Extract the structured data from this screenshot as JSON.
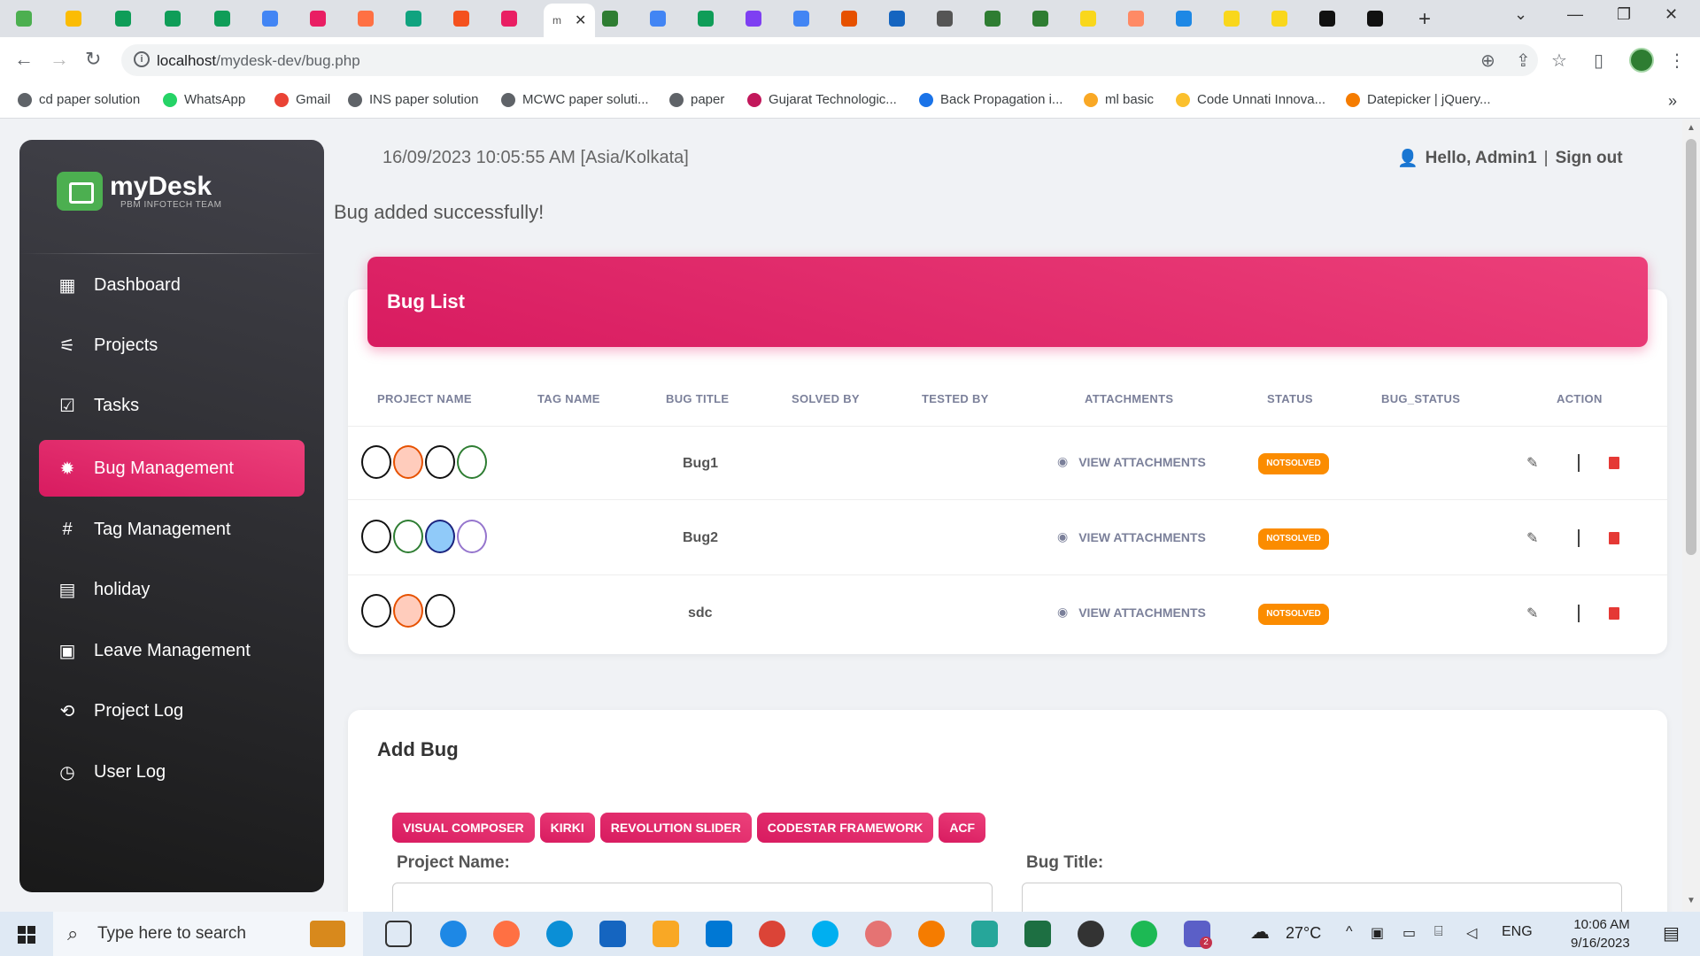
{
  "browser": {
    "active_tab_label": "m",
    "url_host": "localhost",
    "url_path": "/mydesk-dev/bug.php",
    "bookmarks": [
      {
        "label": "cd paper solution",
        "color": "#5f6368"
      },
      {
        "label": "WhatsApp",
        "color": "#25d366"
      },
      {
        "label": "Gmail",
        "color": "#ea4335"
      },
      {
        "label": "INS paper solution",
        "color": "#5f6368"
      },
      {
        "label": "MCWC paper soluti...",
        "color": "#5f6368"
      },
      {
        "label": "paper",
        "color": "#5f6368"
      },
      {
        "label": "Gujarat Technologic...",
        "color": "#c2185b"
      },
      {
        "label": "Back Propagation i...",
        "color": "#1a73e8"
      },
      {
        "label": "ml basic",
        "color": "#f9a825"
      },
      {
        "label": "Code Unnati Innova...",
        "color": "#fbc02d"
      },
      {
        "label": "Datepicker | jQuery...",
        "color": "#f57c00"
      }
    ]
  },
  "sidebar": {
    "brand_name": "myDesk",
    "brand_sub": "PBM INFOTECH TEAM",
    "items": [
      {
        "label": "Dashboard",
        "icon": "▦"
      },
      {
        "label": "Projects",
        "icon": "⚟"
      },
      {
        "label": "Tasks",
        "icon": "☑"
      },
      {
        "label": "Bug Management",
        "icon": "✹"
      },
      {
        "label": "Tag Management",
        "icon": "#"
      },
      {
        "label": "holiday",
        "icon": "▤"
      },
      {
        "label": "Leave Management",
        "icon": "▣"
      },
      {
        "label": "Project Log",
        "icon": "⟲"
      },
      {
        "label": "User Log",
        "icon": "◷"
      }
    ]
  },
  "header": {
    "datetime": "16/09/2023 10:05:55 AM [Asia/Kolkata]",
    "greeting": "Hello, Admin1",
    "separator": "|",
    "signout": "Sign out"
  },
  "flash_message": "Bug added successfully!",
  "bug_list": {
    "title": "Bug List",
    "columns": [
      "PROJECT NAME",
      "TAG NAME",
      "BUG TITLE",
      "SOLVED BY",
      "TESTED BY",
      "ATTACHMENTS",
      "STATUS",
      "BUG_STATUS",
      "ACTION"
    ],
    "rows": [
      {
        "bug_title": "Bug1",
        "attachments": "VIEW ATTACHMENTS",
        "status": "NOTSOLVED"
      },
      {
        "bug_title": "Bug2",
        "attachments": "VIEW ATTACHMENTS",
        "status": "NOTSOLVED"
      },
      {
        "bug_title": "sdc",
        "attachments": "VIEW ATTACHMENTS",
        "status": "NOTSOLVED"
      }
    ]
  },
  "add_bug": {
    "title": "Add Bug",
    "tags": [
      "VISUAL COMPOSER",
      "KIRKI",
      "REVOLUTION SLIDER",
      "CODESTAR FRAMEWORK",
      "ACF"
    ],
    "project_name_label": "Project Name:",
    "bug_title_label": "Bug Title:"
  },
  "taskbar": {
    "search_placeholder": "Type here to search",
    "weather": "27°C",
    "language": "ENG",
    "time": "10:06 AM",
    "date": "9/16/2023",
    "teams_badge": "2"
  },
  "colors": {
    "accent": "#e91e63",
    "status_badge": "#fb8c00",
    "delete": "#e53935"
  }
}
